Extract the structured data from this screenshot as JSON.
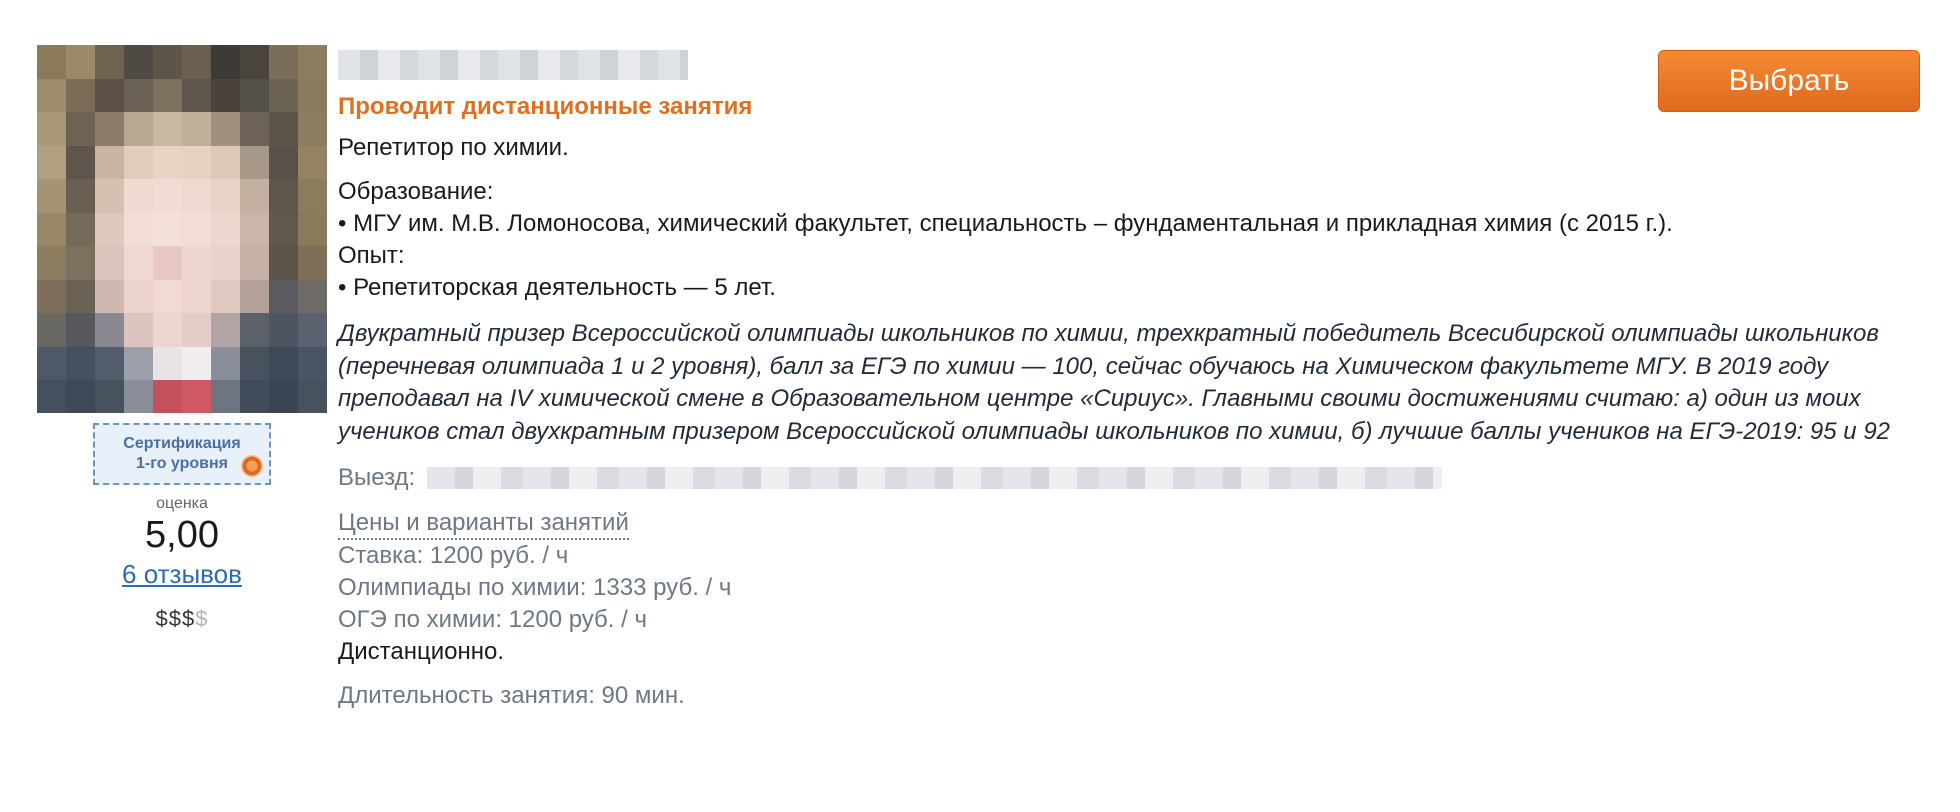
{
  "tutor": {
    "certificate": {
      "line1": "Сертификация",
      "line2": "1-го уровня"
    },
    "rating_label": "оценка",
    "rating_value": "5,00",
    "reviews_link": "6 отзывов",
    "price_level_filled": "$$$",
    "price_level_empty": "$"
  },
  "main": {
    "remote_label": "Проводит дистанционные занятия",
    "subject": "Репетитор по химии.",
    "education_title": "Образование:",
    "education_item": "• МГУ им. М.В. Ломоносова, химический факультет, специальность – фундаментальная и прикладная химия (с 2015 г.).",
    "experience_title": "Опыт:",
    "experience_item": "• Репетиторская деятельность — 5 лет.",
    "about": "Двукратный призер Всероссийской олимпиады школьников по химии, трехкратный победитель Всесибирской олимпиады школьников (перечневая олимпиада 1 и 2 уровня), балл за ЕГЭ по химии — 100, сейчас обучаюсь на Химическом факультете МГУ. В 2019 году преподавал на IV химической смене в Образовательном центре «Сириус». Главными своими достижениями считаю: а) один из моих учеников стал двухкратным призером Всероссийской олимпиады школьников по химии, б) лучшие баллы учеников на ЕГЭ-2019: 95 и 92",
    "travel_label": "Выезд:",
    "prices_link": "Цены и варианты занятий",
    "prices": [
      "Ставка: 1200 руб. / ч",
      "Олимпиады по химии: 1333 руб. / ч",
      "ОГЭ по химии: 1200 руб. / ч"
    ],
    "remote_note": "Дистанционно.",
    "duration": "Длительность занятия: 90 мин."
  },
  "actions": {
    "choose_button": "Выбрать"
  },
  "colors": {
    "accent_orange": "#e0701f",
    "link_blue": "#2d6bb3",
    "muted_grey": "#6d7886"
  }
}
